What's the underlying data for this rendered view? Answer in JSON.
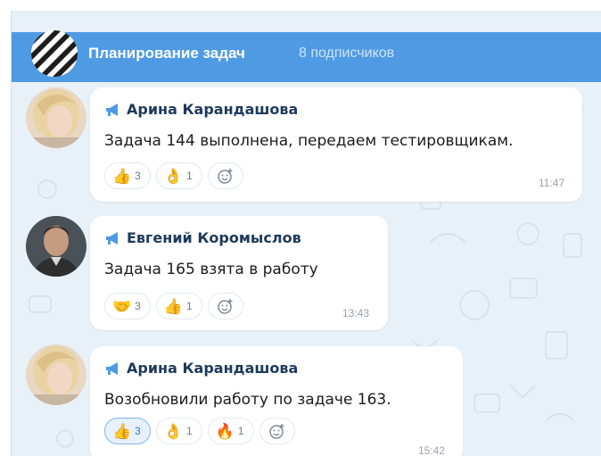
{
  "channel": {
    "title": "Планирование задач",
    "subscribers": "8 подписчиков",
    "header_color": "#4f9be3"
  },
  "messages": [
    {
      "author": "Арина Карандашова",
      "text": "Задача 144 выполнена, передаем тестировщикам.",
      "time": "11:47",
      "reactions": [
        {
          "icon": "thumbs-up",
          "emoji": "👍",
          "count": "3",
          "active": false
        },
        {
          "icon": "ok-hand",
          "emoji": "👌",
          "count": "1",
          "active": false
        }
      ]
    },
    {
      "author": "Евгений Коромыслов",
      "text": "Задача 165 взята в работу",
      "time": "13:43",
      "reactions": [
        {
          "icon": "handshake",
          "emoji": "🤝",
          "count": "3",
          "active": false
        },
        {
          "icon": "thumbs-up",
          "emoji": "👍",
          "count": "1",
          "active": false
        }
      ]
    },
    {
      "author": "Арина Карандашова",
      "text": "Возобновили работу по задаче 163.",
      "time": "15:42",
      "reactions": [
        {
          "icon": "thumbs-up",
          "emoji": "👍",
          "count": "3",
          "active": true
        },
        {
          "icon": "ok-hand",
          "emoji": "👌",
          "count": "1",
          "active": false
        },
        {
          "icon": "fire",
          "emoji": "🔥",
          "count": "1",
          "active": false
        }
      ]
    }
  ],
  "add_reaction_icon": "smile-plus-icon"
}
